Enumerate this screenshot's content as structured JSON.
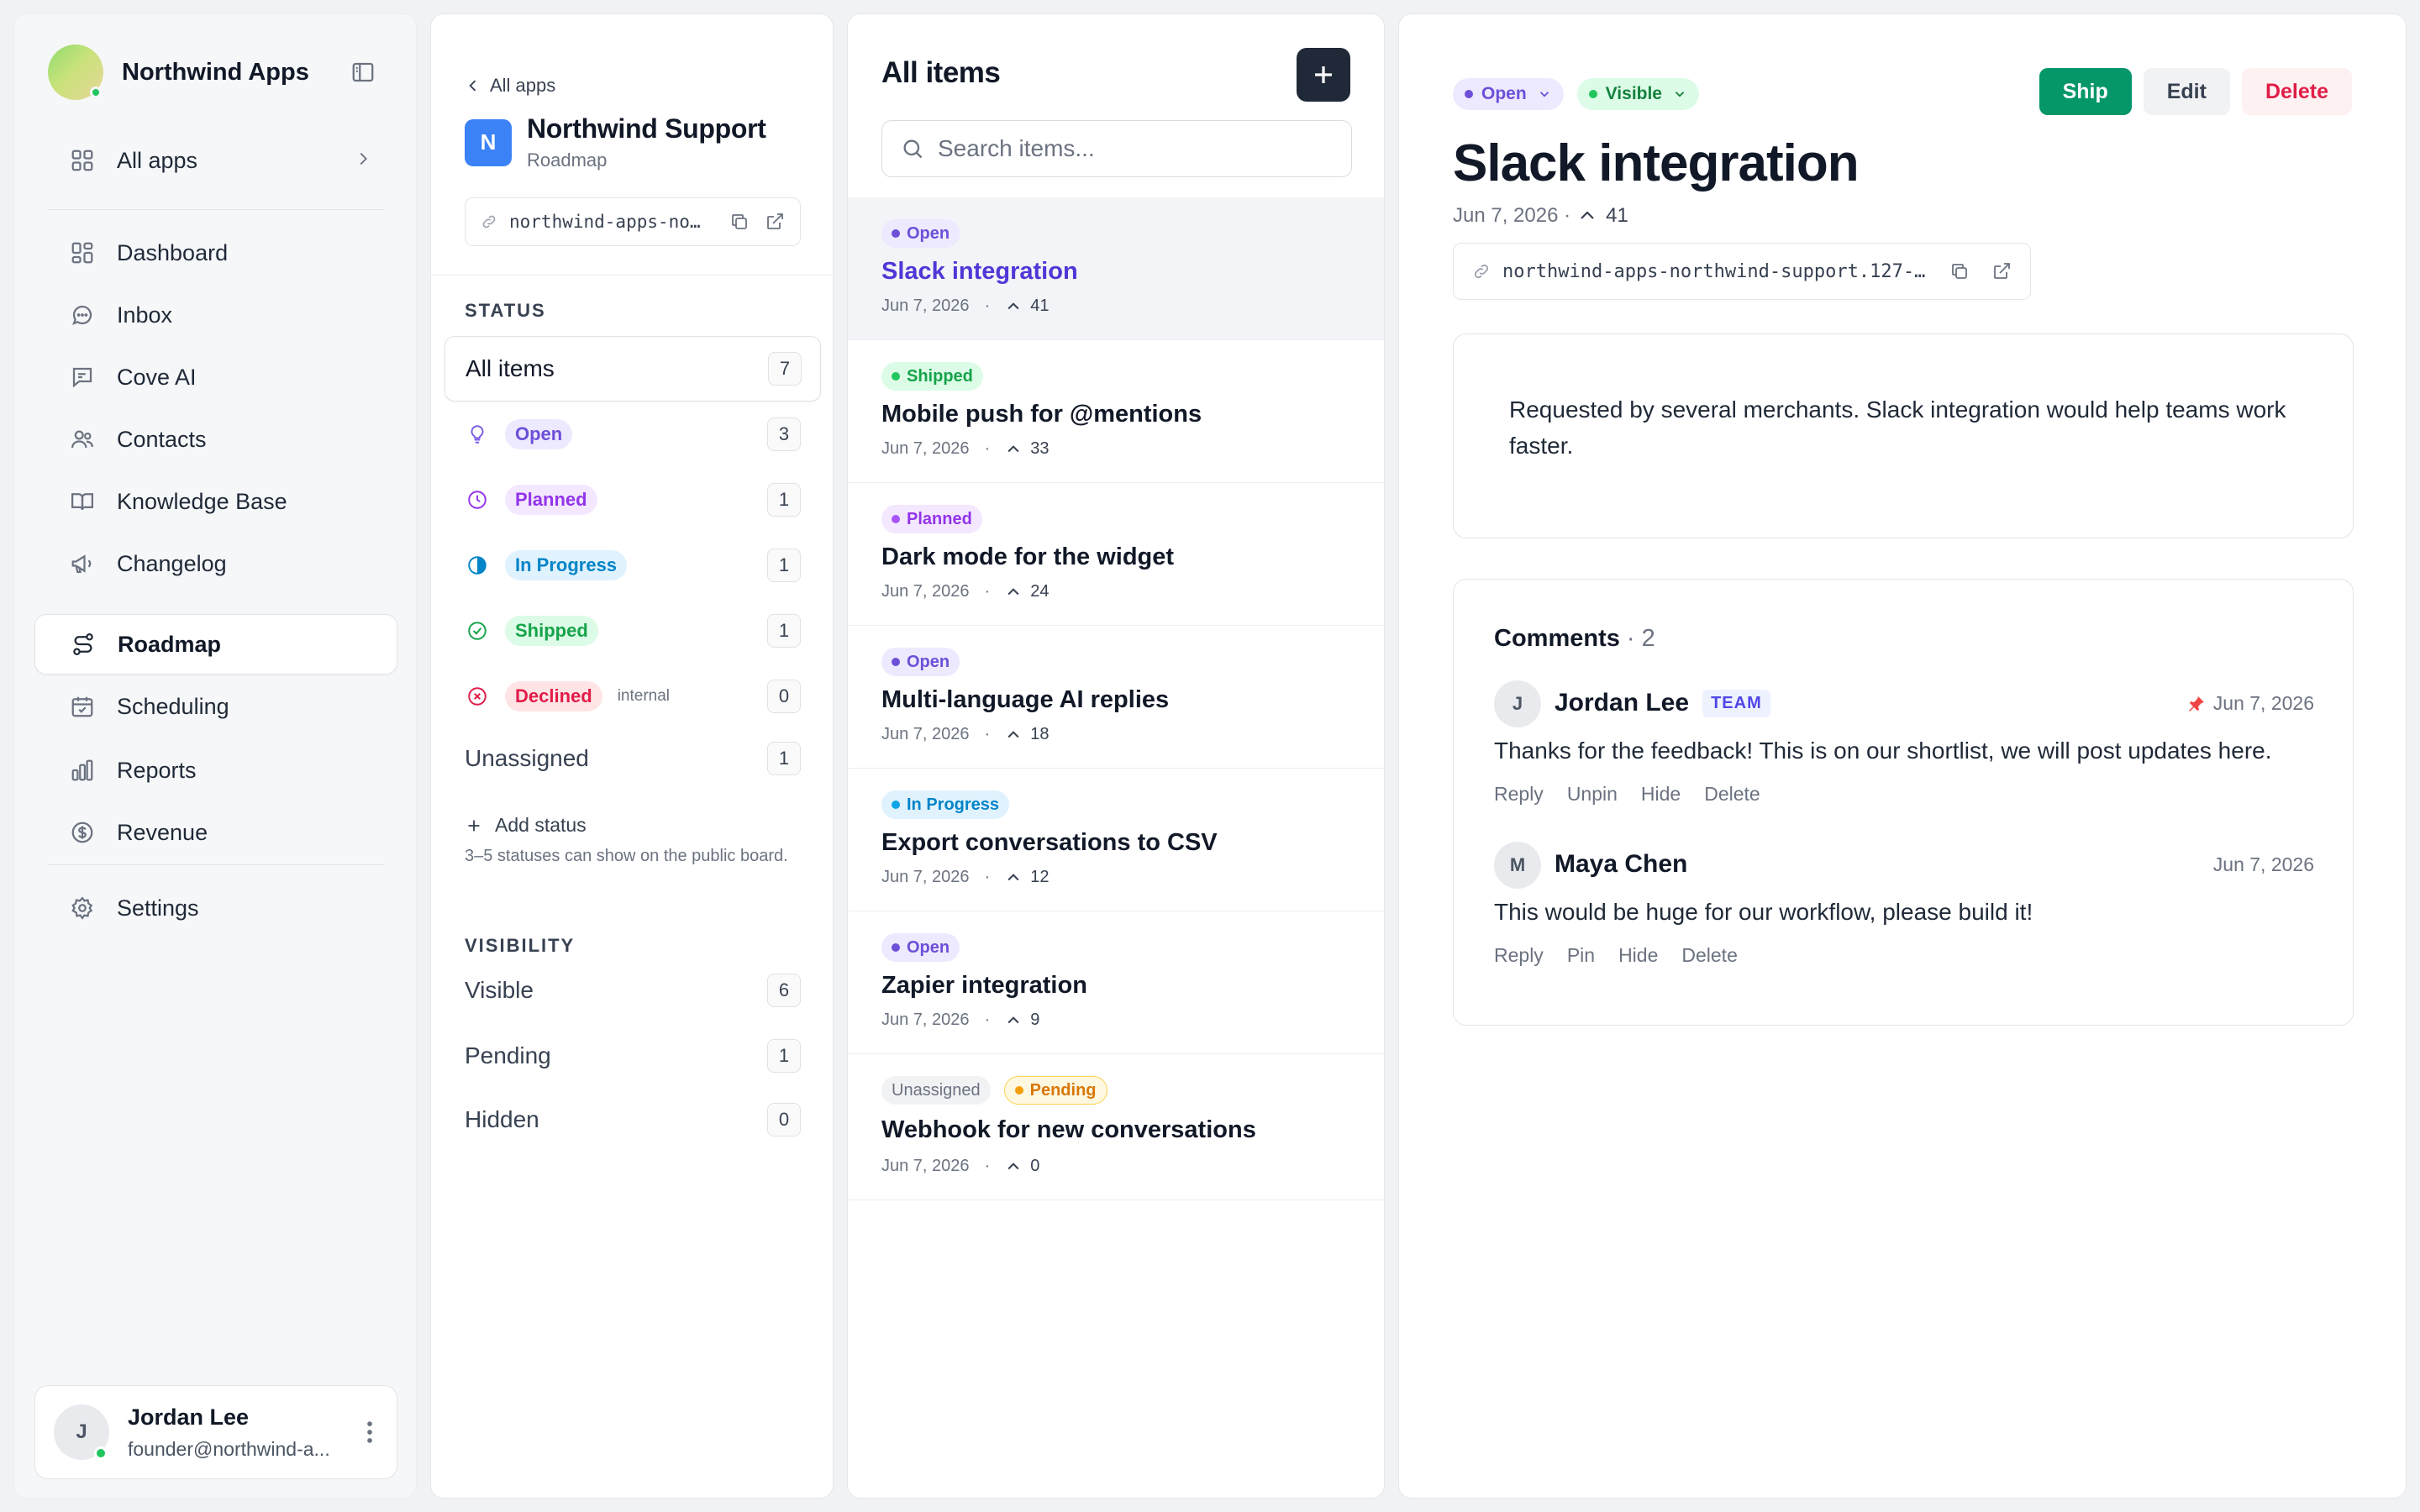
{
  "sidebar": {
    "brand": "Northwind Apps",
    "all_apps": "All apps",
    "items": [
      {
        "label": "Dashboard",
        "icon": "dashboard-icon"
      },
      {
        "label": "Inbox",
        "icon": "inbox-icon"
      },
      {
        "label": "Cove AI",
        "icon": "chat-icon"
      },
      {
        "label": "Contacts",
        "icon": "contacts-icon"
      },
      {
        "label": "Knowledge Base",
        "icon": "book-icon"
      },
      {
        "label": "Changelog",
        "icon": "megaphone-icon"
      },
      {
        "label": "Roadmap",
        "icon": "route-icon"
      },
      {
        "label": "Scheduling",
        "icon": "calendar-icon"
      },
      {
        "label": "Reports",
        "icon": "bar-chart-icon"
      },
      {
        "label": "Revenue",
        "icon": "dollar-icon"
      }
    ],
    "active": "Roadmap",
    "settings": "Settings",
    "user": {
      "initial": "J",
      "name": "Jordan Lee",
      "email": "founder@northwind-a..."
    }
  },
  "status_panel": {
    "back": "All apps",
    "app_initial": "N",
    "app_name": "Northwind Support",
    "app_sub": "Roadmap",
    "url": "northwind-apps-nort...",
    "status_label": "STATUS",
    "all_items": {
      "label": "All items",
      "count": "7"
    },
    "statuses": [
      {
        "label": "Open",
        "count": "3"
      },
      {
        "label": "Planned",
        "count": "1"
      },
      {
        "label": "In Progress",
        "count": "1"
      },
      {
        "label": "Shipped",
        "count": "1"
      },
      {
        "label": "Declined",
        "count": "0",
        "note": "internal"
      }
    ],
    "unassigned": {
      "label": "Unassigned",
      "count": "1"
    },
    "add_status": "Add status",
    "hint": "3–5 statuses can show on the public board.",
    "visibility_label": "VISIBILITY",
    "visibility": [
      {
        "label": "Visible",
        "count": "6"
      },
      {
        "label": "Pending",
        "count": "1"
      },
      {
        "label": "Hidden",
        "count": "0"
      }
    ]
  },
  "list": {
    "title": "All items",
    "search_placeholder": "Search items...",
    "items": [
      {
        "tags": [
          "Open"
        ],
        "title": "Slack integration",
        "date": "Jun 7, 2026",
        "votes": "41"
      },
      {
        "tags": [
          "Shipped"
        ],
        "title": "Mobile push for @mentions",
        "date": "Jun 7, 2026",
        "votes": "33"
      },
      {
        "tags": [
          "Planned"
        ],
        "title": "Dark mode for the widget",
        "date": "Jun 7, 2026",
        "votes": "24"
      },
      {
        "tags": [
          "Open"
        ],
        "title": "Multi-language AI replies",
        "date": "Jun 7, 2026",
        "votes": "18"
      },
      {
        "tags": [
          "In Progress"
        ],
        "title": "Export conversations to CSV",
        "date": "Jun 7, 2026",
        "votes": "12"
      },
      {
        "tags": [
          "Open"
        ],
        "title": "Zapier integration",
        "date": "Jun 7, 2026",
        "votes": "9"
      },
      {
        "tags": [
          "Unassigned",
          "Pending"
        ],
        "title": "Webhook for new conversations",
        "date": "Jun 7, 2026",
        "votes": "0"
      }
    ]
  },
  "detail": {
    "status": "Open",
    "visibility": "Visible",
    "ship": "Ship",
    "edit": "Edit",
    "delete": "Delete",
    "title": "Slack integration",
    "date": "Jun 7, 2026 ·",
    "votes": "41",
    "url": "northwind-apps-northwind-support.127-...",
    "description": "Requested by several merchants. Slack integration would help teams work faster.",
    "comments_label": "Comments",
    "comments_count": "· 2",
    "comments": [
      {
        "initial": "J",
        "name": "Jordan Lee",
        "badge": "TEAM",
        "date": "Jun 7, 2026",
        "pinned": true,
        "body": "Thanks for the feedback! This is on our shortlist, we will post updates here.",
        "actions": [
          "Reply",
          "Unpin",
          "Hide",
          "Delete"
        ]
      },
      {
        "initial": "M",
        "name": "Maya Chen",
        "date": "Jun 7, 2026",
        "pinned": false,
        "body": "This would be huge for our workflow, please build it!",
        "actions": [
          "Reply",
          "Pin",
          "Hide",
          "Delete"
        ]
      }
    ]
  },
  "colors": {
    "accent": "#4f37d6",
    "ship": "#059669",
    "delete": "#e11d48",
    "open": "#6d4fd8",
    "shipped": "#16a34a",
    "planned": "#9333ea",
    "in_progress": "#0284c7",
    "pending": "#d97706"
  }
}
